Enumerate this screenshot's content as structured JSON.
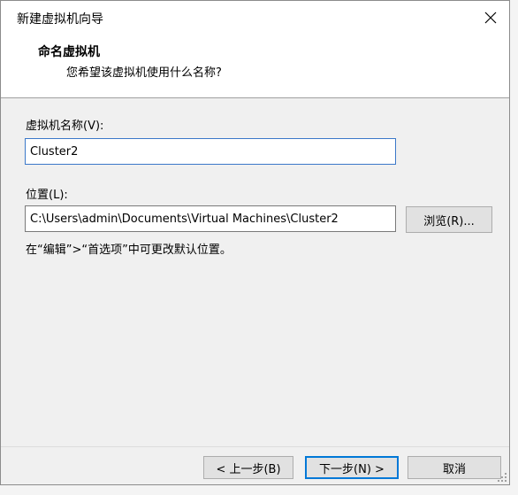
{
  "window": {
    "title": "新建虚拟机向导"
  },
  "header": {
    "title": "命名虚拟机",
    "subtitle": "您希望该虚拟机使用什么名称?"
  },
  "form": {
    "name_label": "虚拟机名称(V):",
    "name_value": "Cluster2",
    "location_label": "位置(L):",
    "location_value": "C:\\Users\\admin\\Documents\\Virtual Machines\\Cluster2",
    "browse_label": "浏览(R)...",
    "hint": "在“编辑”>“首选项”中可更改默认位置。"
  },
  "buttons": {
    "back": "< 上一步(B)",
    "next": "下一步(N) >",
    "cancel": "取消"
  },
  "colors": {
    "accent": "#0078d7",
    "dialog_bg": "#f0f0f0",
    "header_bg": "#ffffff"
  }
}
